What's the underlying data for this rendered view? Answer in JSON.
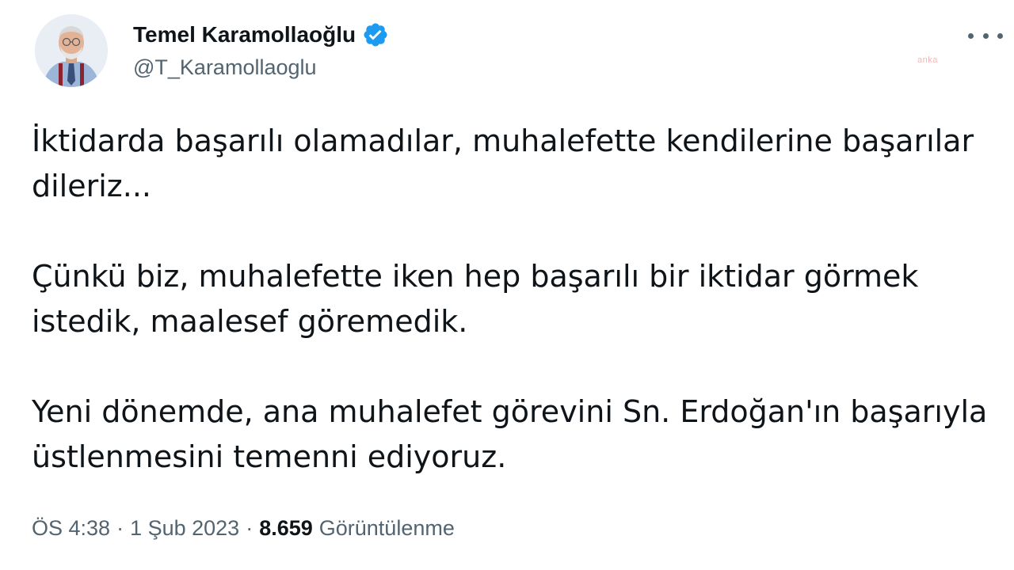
{
  "author": {
    "display_name": "Temel Karamollaoğlu",
    "handle": "@T_Karamollaoglu",
    "verified": true,
    "verified_color": "#1d9bf0"
  },
  "watermark": "anka",
  "tweet": {
    "paragraphs": [
      "İktidarda başarılı olamadılar, muhalefette kendilerine başarılar dileriz...",
      "Çünkü biz, muhalefette iken hep başarılı bir iktidar görmek istedik, maalesef göremedik.",
      "Yeni dönemde, ana muhalefet görevini Sn. Erdoğan'ın başarıyla üstlenmesini temenni ediyoruz."
    ]
  },
  "meta": {
    "time": "ÖS 4:38",
    "separator": "·",
    "date": "1 Şub 2023",
    "views_count": "8.659",
    "views_label": "Görüntülenme"
  },
  "icons": {
    "more": "more-options-icon",
    "verified": "verified-badge-icon"
  }
}
